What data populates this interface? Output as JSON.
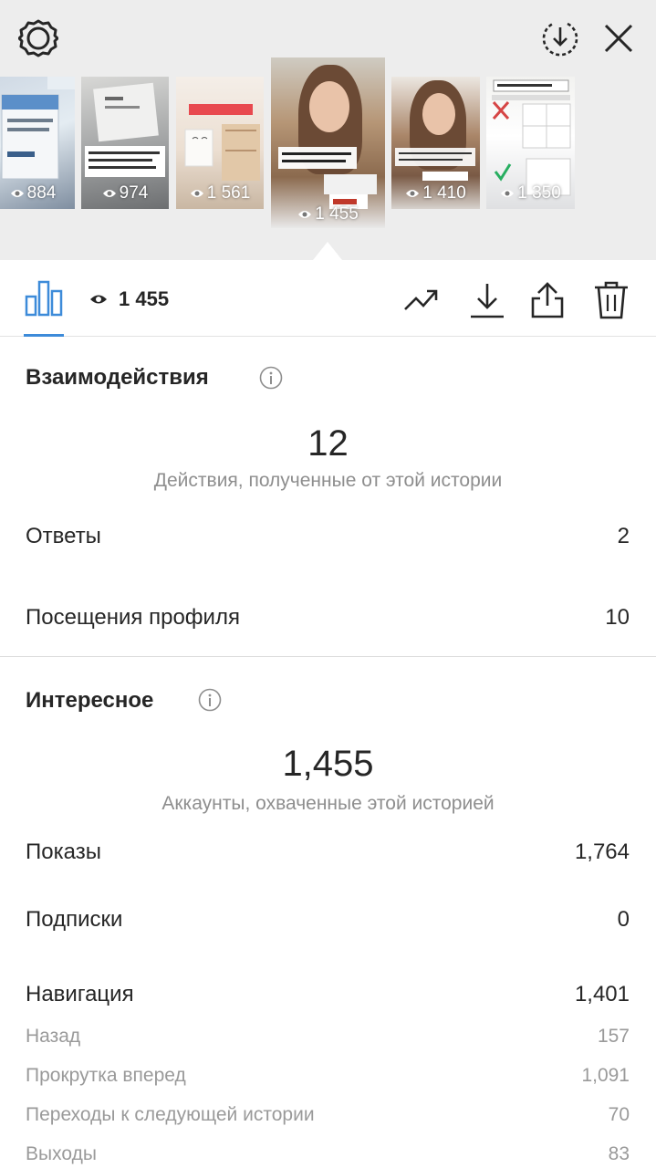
{
  "stories": [
    {
      "views": "884"
    },
    {
      "views": "974"
    },
    {
      "views": "1 561"
    },
    {
      "views": "1 455"
    },
    {
      "views": "1 410"
    },
    {
      "views": "1 350"
    }
  ],
  "toolbar": {
    "view_count": "1 455"
  },
  "interactions": {
    "title": "Взаимодействия",
    "total": "12",
    "subtitle": "Действия, полученные от этой истории",
    "rows": [
      {
        "label": "Ответы",
        "value": "2"
      },
      {
        "label": "Посещения профиля",
        "value": "10"
      }
    ]
  },
  "discovery": {
    "title": "Интересное",
    "total": "1,455",
    "subtitle": "Аккаунты, охваченные этой историей",
    "rows": [
      {
        "label": "Показы",
        "value": "1,764"
      },
      {
        "label": "Подписки",
        "value": "0"
      },
      {
        "label": "Навигация",
        "value": "1,401"
      }
    ],
    "navigation": [
      {
        "label": "Назад",
        "value": "157"
      },
      {
        "label": "Прокрутка вперед",
        "value": "1,091"
      },
      {
        "label": "Переходы к следующей истории",
        "value": "70"
      },
      {
        "label": "Выходы",
        "value": "83"
      }
    ]
  },
  "colors": {
    "accent": "#3d8bd9",
    "top_background": "#ededed",
    "muted_text": "#8e8e8e"
  },
  "icons": [
    "gear-icon",
    "download-circle-icon",
    "close-icon",
    "bar-chart-icon",
    "eye-icon",
    "trend-icon",
    "download-icon",
    "share-icon",
    "trash-icon",
    "info-icon"
  ]
}
